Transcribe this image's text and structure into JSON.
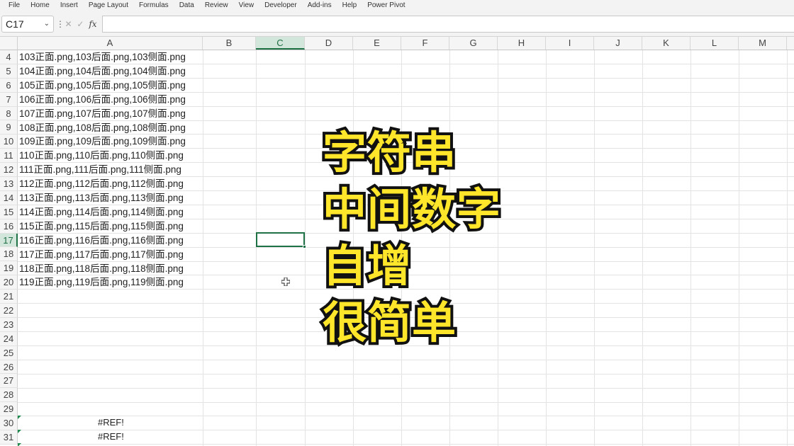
{
  "menu": [
    "File",
    "Home",
    "Insert",
    "Page Layout",
    "Formulas",
    "Data",
    "Review",
    "View",
    "Developer",
    "Add-ins",
    "Help",
    "Power Pivot"
  ],
  "formula_bar": {
    "name_box": "C17",
    "cancel_icon": "close-icon",
    "enter_icon": "check-icon",
    "fx_label": "fx",
    "formula": ""
  },
  "columns": [
    "A",
    "B",
    "C",
    "D",
    "E",
    "F",
    "G",
    "H",
    "I",
    "J",
    "K",
    "L",
    "M"
  ],
  "active_column": "C",
  "active_row": "17",
  "rows": [
    "4",
    "5",
    "6",
    "7",
    "8",
    "9",
    "10",
    "11",
    "12",
    "13",
    "14",
    "15",
    "16",
    "17",
    "18",
    "19",
    "20",
    "21",
    "22",
    "23",
    "24",
    "25",
    "26",
    "27",
    "28",
    "29",
    "30",
    "31"
  ],
  "column_a": [
    "103正面.png,103后面.png,103侧面.png",
    "104正面.png,104后面.png,104侧面.png",
    "105正面.png,105后面.png,105侧面.png",
    "106正面.png,106后面.png,106侧面.png",
    "107正面.png,107后面.png,107侧面.png",
    "108正面.png,108后面.png,108侧面.png",
    "109正面.png,109后面.png,109侧面.png",
    "110正面.png,110后面.png,110侧面.png",
    "111正面.png,111后面.png,111侧面.png",
    "112正面.png,112后面.png,112侧面.png",
    "113正面.png,113后面.png,113侧面.png",
    "114正面.png,114后面.png,114侧面.png",
    "115正面.png,115后面.png,115侧面.png",
    "116正面.png,116后面.png,116侧面.png",
    "117正面.png,117后面.png,117侧面.png",
    "118正面.png,118后面.png,118侧面.png",
    "119正面.png,119后面.png,119侧面.png"
  ],
  "errors": [
    "#REF!",
    "#REF!"
  ],
  "overlay_lines": [
    "字符串",
    "中间数字",
    "自增",
    "很简单"
  ],
  "colors": {
    "accent": "#1f7246",
    "overlay_fill": "#ffe62a",
    "overlay_stroke": "#111111"
  }
}
